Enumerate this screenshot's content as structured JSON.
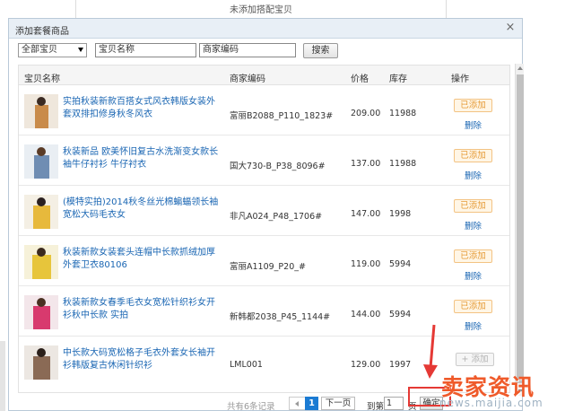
{
  "background": {
    "notice": "未添加搭配宝贝"
  },
  "dialog": {
    "title": "添加套餐商品",
    "close_label": "×",
    "filter": {
      "category_selected": "全部宝贝",
      "name_input_value": "宝贝名称",
      "code_input_value": "商家编码",
      "search_label": "搜索"
    },
    "table": {
      "headers": {
        "name": "宝贝名称",
        "code": "商家编码",
        "price": "价格",
        "stock": "库存",
        "action": "操作"
      },
      "rows": [
        {
          "name": "实拍秋装新款百搭女式风衣韩版女装外套双排扣修身秋冬风衣",
          "code": "富丽B2088_P110_1823#",
          "price": "209.00",
          "stock": "11988",
          "action": "已添加",
          "delete": "删除",
          "thumb_color": "#c98b4a"
        },
        {
          "name": "秋装新品 欧美怀旧复古水洗渐变女款长袖牛仔衬衫 牛仔衬衣",
          "code": "国大730-B_P38_8096#",
          "price": "137.00",
          "stock": "11988",
          "action": "已添加",
          "delete": "删除",
          "thumb_color": "#6f8db3"
        },
        {
          "name": "(模特实拍)2014秋冬丝光棉蝙蝠领长袖宽松大码毛衣女",
          "code": "非凡A024_P48_1706#",
          "price": "147.00",
          "stock": "1998",
          "action": "已添加",
          "delete": "删除",
          "thumb_color": "#e7b93c"
        },
        {
          "name": "秋装新款女装套头连帽中长款抓绒加厚外套卫衣80106",
          "code": "富丽A1109_P20_#",
          "price": "119.00",
          "stock": "5994",
          "action": "已添加",
          "delete": "删除",
          "thumb_color": "#e7c53b"
        },
        {
          "name": "秋装新款女春季毛衣女宽松针织衫女开衫秋中长款 实拍",
          "code": "新韩都2038_P45_1144#",
          "price": "144.00",
          "stock": "5994",
          "action": "已添加",
          "delete": "删除",
          "thumb_color": "#d83a6e"
        },
        {
          "name": "中长款大码宽松格子毛衣外套女长袖开衫韩版复古休闲针织衫",
          "code": "LML001",
          "price": "129.00",
          "stock": "1997",
          "action": "+ 添加",
          "delete": "",
          "thumb_color": "#8a6a55"
        }
      ]
    },
    "pager": {
      "total_text": "共有6条记录",
      "current_page": "1",
      "next_label": "下一页",
      "goto_label": "到第",
      "goto_value": "1",
      "page_unit": "页",
      "confirm_label": "确定"
    }
  },
  "watermark": {
    "main": "卖家资讯",
    "sub": "news.maijia.com"
  },
  "colors": {
    "link": "#1a66b3",
    "added_text": "#e69b37",
    "highlight": "#e53935",
    "pager_active": "#1b7bd3"
  }
}
